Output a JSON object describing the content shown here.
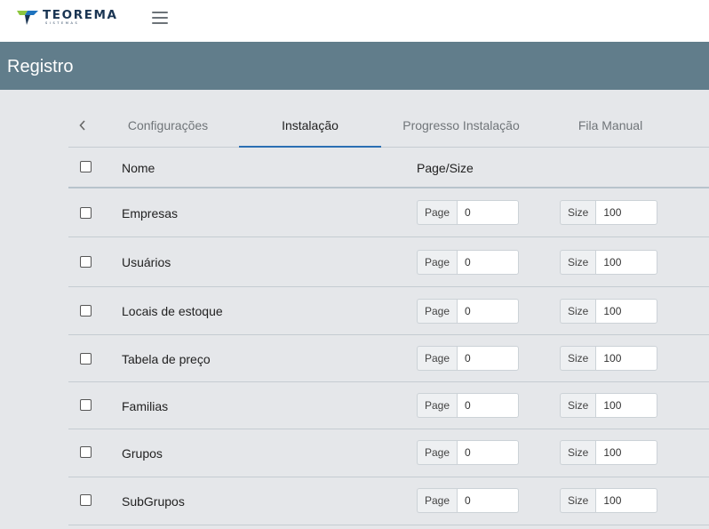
{
  "brand": {
    "name": "TEOREMA",
    "subtitle": "SISTEMAS",
    "colors": {
      "mark_green": "#8dc63f",
      "mark_blue": "#1e73be",
      "text": "#1a3553"
    }
  },
  "topbar": {
    "menu_icon": "hamburger-icon"
  },
  "header": {
    "title": "Registro",
    "background": "#617d8b"
  },
  "tabs": [
    {
      "label": "Configurações",
      "active": false
    },
    {
      "label": "Instalação",
      "active": true
    },
    {
      "label": "Progresso Instalação",
      "active": false
    },
    {
      "label": "Fila Manual",
      "active": false
    }
  ],
  "table": {
    "columns": {
      "name": "Nome",
      "page_size": "Page/Size"
    },
    "page_label": "Page",
    "size_label": "Size",
    "rows": [
      {
        "name": "Empresas",
        "page": "0",
        "size": "100"
      },
      {
        "name": "Usuários",
        "page": "0",
        "size": "100"
      },
      {
        "name": "Locais de estoque",
        "page": "0",
        "size": "100"
      },
      {
        "name": "Tabela de preço",
        "page": "0",
        "size": "100"
      },
      {
        "name": "Familias",
        "page": "0",
        "size": "100"
      },
      {
        "name": "Grupos",
        "page": "0",
        "size": "100"
      },
      {
        "name": "SubGrupos",
        "page": "0",
        "size": "100"
      }
    ]
  }
}
